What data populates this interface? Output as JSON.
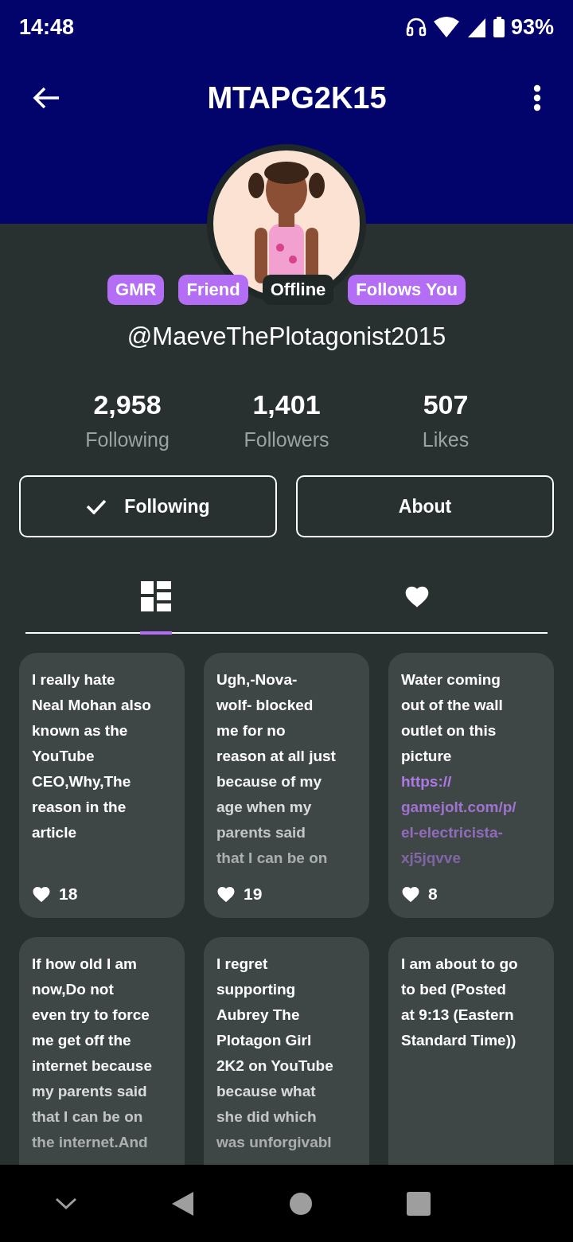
{
  "status_bar": {
    "time": "14:48",
    "battery": "93%"
  },
  "header": {
    "title": "MTAPG2K15"
  },
  "profile": {
    "badges": [
      {
        "label": "GMR",
        "color": "#b36ef5"
      },
      {
        "label": "Friend",
        "color": "#b36ef5"
      },
      {
        "label": "Offline",
        "color": "#1f2727"
      },
      {
        "label": "Follows You",
        "color": "#b36ef5"
      }
    ],
    "username": "@MaeveThePlotagonist2015",
    "stats": [
      {
        "value": "2,958",
        "label": "Following"
      },
      {
        "value": "1,401",
        "label": "Followers"
      },
      {
        "value": "507",
        "label": "Likes"
      }
    ],
    "buttons": [
      {
        "label": "Following",
        "checked": true
      },
      {
        "label": "About",
        "checked": false
      }
    ]
  },
  "tabs": [
    {
      "kind": "posts",
      "selected": true
    },
    {
      "kind": "likes",
      "selected": false
    }
  ],
  "posts": [
    {
      "lines": [
        "I really hate",
        "Neal Mohan also",
        "known as the",
        "YouTube",
        "CEO,Why,The",
        "reason in the",
        "article"
      ],
      "likes": "18"
    },
    {
      "lines": [
        "Ugh,-Nova-",
        "wolf- blocked",
        "me for no",
        "reason at all just",
        "because of my",
        "age when my",
        "parents said",
        "that I can be on"
      ],
      "likes": "19"
    },
    {
      "lines": [
        "Water coming",
        "out of the wall",
        "outlet on this",
        "picture"
      ],
      "link_lines": [
        "https://",
        "gamejolt.com/p/",
        "el-electricista-",
        "xj5jqvve"
      ],
      "likes": "8"
    },
    {
      "lines": [
        "If how old I am",
        "now,Do not",
        "even try to force",
        "me get off the",
        "internet because",
        "my parents said",
        "that I can be on",
        "the internet.And"
      ]
    },
    {
      "lines": [
        "I regret",
        "supporting",
        "Aubrey The",
        "Plotagon Girl",
        "2K2 on YouTube",
        "because what",
        "she did which",
        "was unforgivabl"
      ]
    },
    {
      "lines": [
        "I am about to go",
        "to bed (Posted",
        "at 9:13 (Eastern",
        "Standard Time))"
      ]
    }
  ]
}
